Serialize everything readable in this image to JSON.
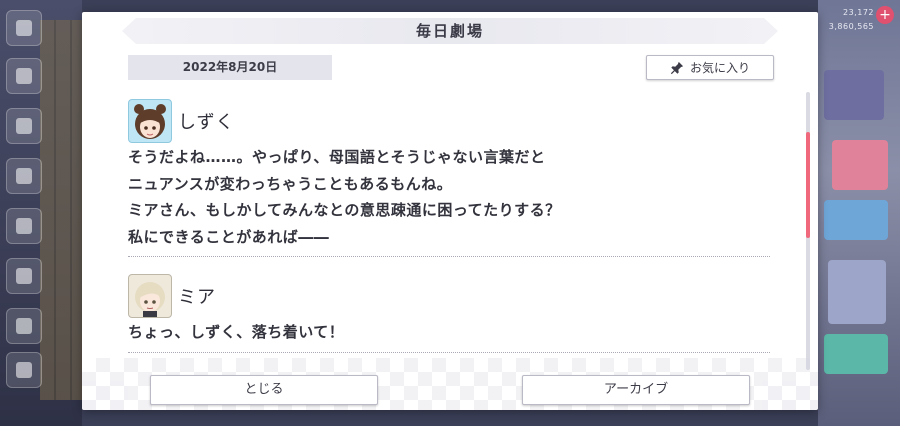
{
  "dialog": {
    "title": "毎日劇場",
    "date": "2022年8月20日",
    "favorite_label": "お気に入り",
    "entries": [
      {
        "speaker": "しずく",
        "lines": [
          "そうだよね……。やっぱり、母国語とそうじゃない言葉だと",
          "ニュアンスが変わっちゃうこともあるもんね。",
          "ミアさん、もしかしてみんなとの意思疎通に困ってたりする？",
          "私にできることがあれば――"
        ]
      },
      {
        "speaker": "ミア",
        "lines": [
          "ちょっ、しずく、落ち着いて！"
        ]
      }
    ],
    "close_label": "とじる",
    "archive_label": "アーカイブ",
    "scroll_position": 0.23
  },
  "background": {
    "top_stats": [
      "23,172",
      "3,860,565"
    ]
  },
  "colors": {
    "accent": "#f0687c",
    "text": "#33333d",
    "date_bg": "#e4e4ec"
  },
  "icons": {
    "favorite": "pin-icon",
    "shizuku_avatar": "character-portrait",
    "mia_avatar": "character-portrait"
  }
}
